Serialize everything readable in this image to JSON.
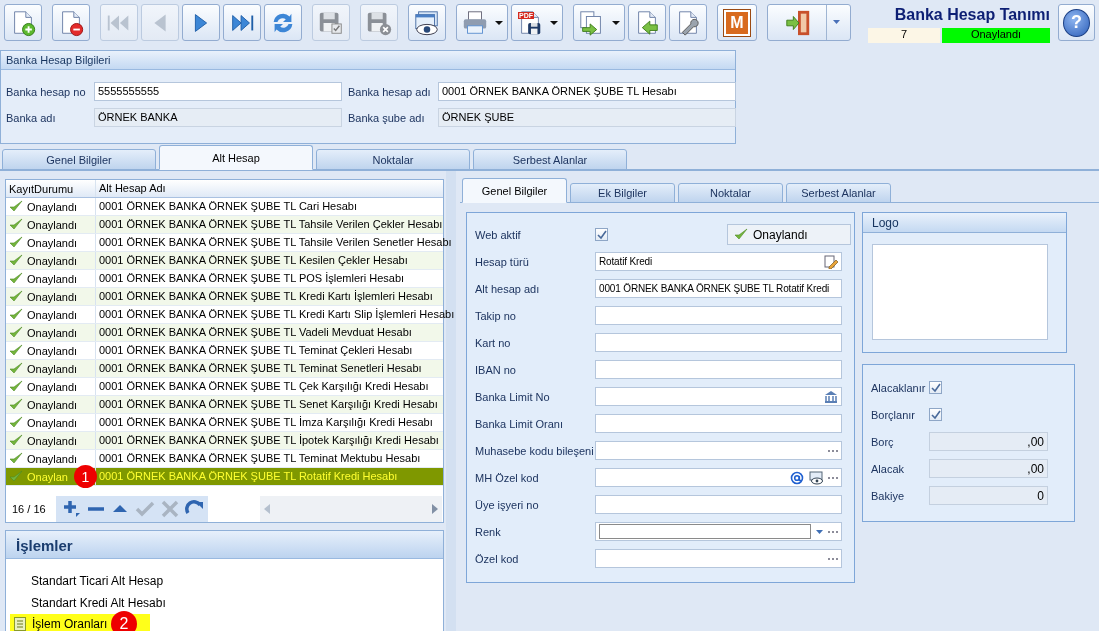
{
  "toolbar": {
    "groups": [
      [
        {
          "kind": "new",
          "disabled": false,
          "dropdown": false
        }
      ],
      [
        {
          "kind": "delete",
          "disabled": false,
          "dropdown": false
        }
      ],
      [
        {
          "kind": "first",
          "disabled": true,
          "dropdown": false
        },
        {
          "kind": "previous",
          "disabled": true,
          "dropdown": false
        },
        {
          "kind": "next",
          "disabled": false,
          "dropdown": false
        },
        {
          "kind": "last",
          "disabled": false,
          "dropdown": false
        },
        {
          "kind": "refresh",
          "disabled": false,
          "dropdown": false
        }
      ],
      [
        {
          "kind": "save",
          "disabled": true,
          "dropdown": false
        }
      ],
      [
        {
          "kind": "discard",
          "disabled": true,
          "dropdown": false
        }
      ],
      [
        {
          "kind": "preview",
          "disabled": false,
          "dropdown": false
        }
      ],
      [
        {
          "kind": "print",
          "disabled": false,
          "dropdown": true
        },
        {
          "kind": "pdf",
          "label": "PDF",
          "disabled": false,
          "dropdown": true
        }
      ],
      [
        {
          "kind": "export",
          "disabled": false,
          "dropdown": true
        },
        {
          "kind": "import",
          "disabled": false,
          "dropdown": false
        },
        {
          "kind": "tools",
          "disabled": false,
          "dropdown": false
        }
      ],
      [
        {
          "kind": "module",
          "label": "M",
          "disabled": false,
          "dropdown": false
        }
      ],
      [
        {
          "kind": "exit",
          "disabled": false,
          "dropdown": true
        }
      ]
    ]
  },
  "title": {
    "text": "Banka Hesap Tanımı",
    "record_no": "7",
    "status": "Onaylandı"
  },
  "help_button": {
    "label": "?"
  },
  "account": {
    "title": "Banka Hesap Bilgileri",
    "fields": [
      {
        "label": "Banka hesap no",
        "value": "5555555555",
        "readonly": false
      },
      {
        "label": "Banka hesap adı",
        "value": "0001 ÖRNEK BANKA ÖRNEK ŞUBE TL Hesabı",
        "readonly": false
      },
      {
        "label": "Banka adı",
        "value": "ÖRNEK BANKA",
        "readonly": true
      },
      {
        "label": "Banka şube adı",
        "value": "ÖRNEK ŞUBE",
        "readonly": true
      }
    ]
  },
  "tabs": [
    {
      "label": "Genel Bilgiler",
      "selected": false
    },
    {
      "label": "Alt Hesap",
      "selected": true
    },
    {
      "label": "Noktalar",
      "selected": false
    },
    {
      "label": "Serbest Alanlar",
      "selected": false
    }
  ],
  "sub_accounts": {
    "columns": [
      "KayıtDurumu",
      "Alt Hesap Adı"
    ],
    "rows": [
      {
        "status": "Onaylandı",
        "name": "0001 ÖRNEK BANKA ÖRNEK ŞUBE TL Cari Hesabı",
        "selected": false
      },
      {
        "status": "Onaylandı",
        "name": "0001 ÖRNEK BANKA ÖRNEK ŞUBE TL Tahsile Verilen Çekler Hesabı",
        "selected": false
      },
      {
        "status": "Onaylandı",
        "name": "0001 ÖRNEK BANKA ÖRNEK ŞUBE TL Tahsile Verilen Senetler Hesabı",
        "selected": false
      },
      {
        "status": "Onaylandı",
        "name": "0001 ÖRNEK BANKA ÖRNEK ŞUBE TL Kesilen Çekler Hesabı",
        "selected": false
      },
      {
        "status": "Onaylandı",
        "name": "0001 ÖRNEK BANKA ÖRNEK ŞUBE TL POS İşlemleri Hesabı",
        "selected": false
      },
      {
        "status": "Onaylandı",
        "name": "0001 ÖRNEK BANKA ÖRNEK ŞUBE TL Kredi Kartı İşlemleri Hesabı",
        "selected": false
      },
      {
        "status": "Onaylandı",
        "name": "0001 ÖRNEK BANKA ÖRNEK ŞUBE TL Kredi Kartı Slip İşlemleri Hesabı",
        "selected": false
      },
      {
        "status": "Onaylandı",
        "name": "0001 ÖRNEK BANKA ÖRNEK ŞUBE TL Vadeli Mevduat Hesabı",
        "selected": false
      },
      {
        "status": "Onaylandı",
        "name": "0001 ÖRNEK BANKA ÖRNEK ŞUBE TL Teminat Çekleri Hesabı",
        "selected": false
      },
      {
        "status": "Onaylandı",
        "name": "0001 ÖRNEK BANKA ÖRNEK ŞUBE TL Teminat Senetleri Hesabı",
        "selected": false
      },
      {
        "status": "Onaylandı",
        "name": "0001 ÖRNEK BANKA ÖRNEK ŞUBE TL Çek Karşılığı Kredi Hesabı",
        "selected": false
      },
      {
        "status": "Onaylandı",
        "name": "0001 ÖRNEK BANKA ÖRNEK ŞUBE TL Senet Karşılığı Kredi Hesabı",
        "selected": false
      },
      {
        "status": "Onaylandı",
        "name": "0001 ÖRNEK BANKA ÖRNEK ŞUBE TL İmza Karşılığı Kredi Hesabı",
        "selected": false
      },
      {
        "status": "Onaylandı",
        "name": "0001 ÖRNEK BANKA ÖRNEK ŞUBE TL İpotek Karşılığı Kredi Hesabı",
        "selected": false
      },
      {
        "status": "Onaylandı",
        "name": "0001 ÖRNEK BANKA ÖRNEK ŞUBE TL Teminat Mektubu Hesabı",
        "selected": false
      },
      {
        "status": "Onaylan",
        "name": "0001 ÖRNEK BANKA ÖRNEK ŞUBE TL Rotatif Kredi Hesabı",
        "selected": true,
        "marker": "1"
      }
    ],
    "counter": "16 / 16",
    "nav": [
      {
        "kind": "add",
        "disabled": false
      },
      {
        "kind": "remove",
        "disabled": false
      },
      {
        "kind": "up",
        "disabled": false
      },
      {
        "kind": "confirm",
        "disabled": true
      },
      {
        "kind": "cancel",
        "disabled": true
      },
      {
        "kind": "redo",
        "disabled": false
      }
    ]
  },
  "actions": {
    "title": "İşlemler",
    "items": [
      {
        "label": "Standart Ticari Alt Hesap",
        "selected": false
      },
      {
        "label": "Standart Kredi Alt Hesabı",
        "selected": false
      },
      {
        "label": "İşlem Oranları",
        "selected": true,
        "marker": "2"
      }
    ]
  },
  "detail_tabs": [
    {
      "label": "Genel Bilgiler",
      "selected": true
    },
    {
      "label": "Ek Bilgiler",
      "selected": false
    },
    {
      "label": "Noktalar",
      "selected": false
    },
    {
      "label": "Serbest Alanlar",
      "selected": false
    }
  ],
  "detail_form": {
    "fields": [
      {
        "kind": "checkbox",
        "label": "Web aktif",
        "checked": true,
        "status": "Onaylandı"
      },
      {
        "kind": "text",
        "label": "Hesap türü",
        "value": "Rotatif Kredi",
        "buttons": [
          {
            "kind": "edit"
          }
        ]
      },
      {
        "kind": "text",
        "label": "Alt hesap adı",
        "value": "0001 ÖRNEK BANKA ÖRNEK ŞUBE TL Rotatif Kredi"
      },
      {
        "kind": "text",
        "label": "Takip no"
      },
      {
        "kind": "text",
        "label": "Kart no"
      },
      {
        "kind": "text",
        "label": "IBAN no"
      },
      {
        "kind": "text",
        "label": "Banka Limit No",
        "buttons": [
          {
            "kind": "bank"
          }
        ]
      },
      {
        "kind": "text",
        "label": "Banka Limit Oranı"
      },
      {
        "kind": "text",
        "label": "Muhasebe kodu bileşeni",
        "buttons": [
          {
            "kind": "more"
          }
        ]
      },
      {
        "kind": "text",
        "label": "MH Özel kod",
        "buttons": [
          {
            "kind": "at"
          },
          {
            "kind": "view"
          },
          {
            "kind": "more"
          }
        ]
      },
      {
        "kind": "text",
        "label": "Üye işyeri no"
      },
      {
        "kind": "color",
        "label": "Renk",
        "buttons": [
          {
            "kind": "more"
          }
        ]
      },
      {
        "kind": "text",
        "label": "Özel kod",
        "buttons": [
          {
            "kind": "more"
          }
        ]
      }
    ]
  },
  "logo": {
    "title": "Logo"
  },
  "totals": {
    "flags": [
      {
        "label": "Alacaklanır",
        "checked": true
      },
      {
        "label": "Borçlanır",
        "checked": true
      }
    ],
    "amounts": [
      {
        "label": "Borç",
        "value": ",00"
      },
      {
        "label": "Alacak",
        "value": ",00"
      },
      {
        "label": "Bakiye",
        "value": "0"
      }
    ]
  }
}
